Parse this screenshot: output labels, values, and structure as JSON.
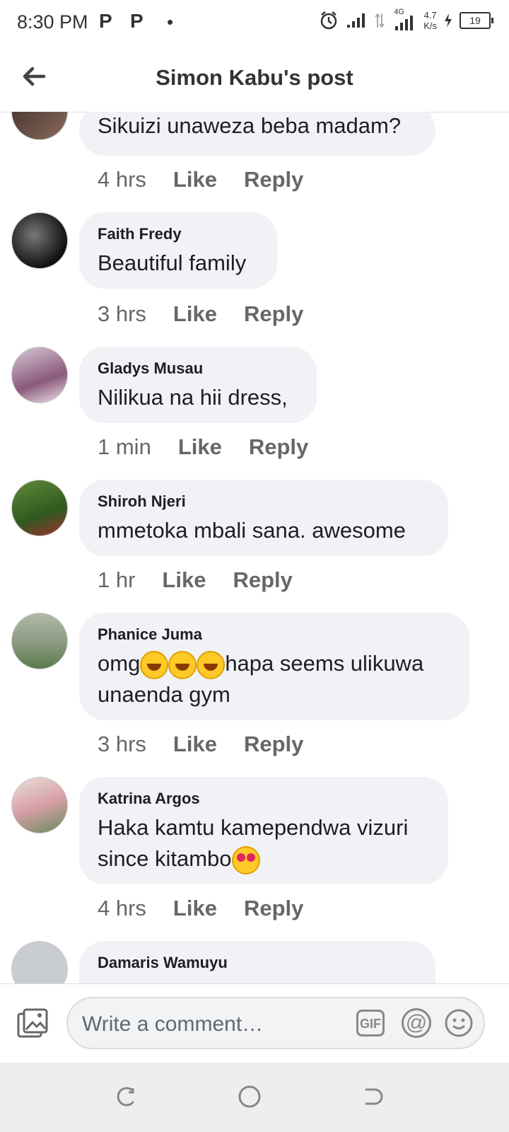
{
  "status": {
    "time": "8:30 PM",
    "p1": "P",
    "p2": "P",
    "dot": "•",
    "network": "4G",
    "speed_value": "4.7",
    "speed_unit": "K/s",
    "battery": "19"
  },
  "header": {
    "title": "Simon Kabu's post"
  },
  "comments": [
    {
      "name": "",
      "text": "Sikuizi unaweza beba madam?",
      "time": "4 hrs",
      "like": "Like",
      "reply": "Reply"
    },
    {
      "name": "Faith Fredy",
      "text": "Beautiful family",
      "time": "3 hrs",
      "like": "Like",
      "reply": "Reply"
    },
    {
      "name": "Gladys Musau",
      "text": "Nilikua na hii dress,",
      "time": "1 min",
      "like": "Like",
      "reply": "Reply"
    },
    {
      "name": "Shiroh Njeri",
      "text": "mmetoka mbali sana. awesome",
      "time": "1 hr",
      "like": "Like",
      "reply": "Reply"
    },
    {
      "name": "Phanice Juma",
      "text_a": "omg",
      "text_b": "hapa seems ulikuwa",
      "text_c": "unaenda gym",
      "time": "3 hrs",
      "like": "Like",
      "reply": "Reply"
    },
    {
      "name": "Katrina Argos",
      "text_a": "Haka kamtu kamependwa vizuri",
      "text_b": "since kitambo",
      "time": "4 hrs",
      "like": "Like",
      "reply": "Reply"
    },
    {
      "name": "Damaris Wamuyu"
    }
  ],
  "composer": {
    "placeholder": "Write a comment…",
    "gif": "GIF",
    "at": "@"
  },
  "colors": {
    "bubble": "#f0f2f5",
    "meta": "#65676b",
    "text": "#1c1e21"
  },
  "icons": {
    "back": "arrow-left-icon",
    "photo": "photo-icon",
    "gif": "gif-icon",
    "mention": "at-icon",
    "emoji": "smiley-icon"
  }
}
